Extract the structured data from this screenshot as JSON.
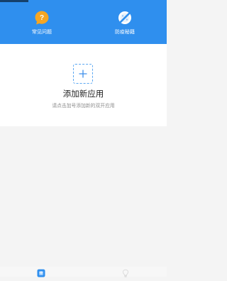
{
  "header": {
    "actions": [
      {
        "label": "常见问题",
        "icon": "question-bubble-icon",
        "icon_color": "#f5a623"
      },
      {
        "label": "防疫秘籍",
        "icon": "no-virus-icon",
        "icon_color": "#ffffff"
      }
    ],
    "background_color": "#2f8fee"
  },
  "empty_state": {
    "title": "添加新应用",
    "subtitle": "请点击加号添加新的双开应用",
    "add_icon": "plus-icon"
  },
  "bottom_nav": {
    "items": [
      {
        "icon": "apps-icon",
        "active": true
      },
      {
        "icon": "lightbulb-icon",
        "active": false
      }
    ]
  }
}
